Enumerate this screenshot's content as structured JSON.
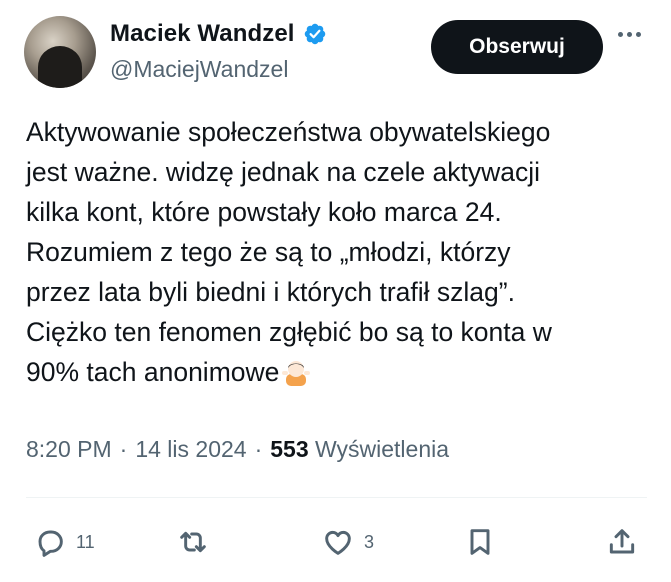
{
  "author": {
    "display_name": "Maciek Wandzel",
    "handle": "@MaciejWandzel",
    "verified_color": "#1d9bf0"
  },
  "follow_button_label": "Obserwuj",
  "tweet": {
    "text": "Aktywowanie społeczeństwa obywatelskiego\njest ważne. widzę jednak na czele aktywacji\nkilka kont, które powstały koło marca 24.\nRozumiem z tego że są to „młodzi, którzy\nprzez lata byli biedni i których trafił szlag”.\nCiężko ten fenomen zgłębić bo są to konta w\n90% tach anonimowe",
    "emoji": "person-shrugging-emoji"
  },
  "meta": {
    "time": "8:20 PM",
    "separator": "·",
    "date": "14 lis 2024",
    "views_count": "553",
    "views_label": "Wyświetlenia"
  },
  "actions": {
    "reply_count": "11",
    "retweet_count": "",
    "like_count": "3"
  },
  "colors": {
    "text": "#0f1419",
    "secondary": "#536471",
    "button_bg": "#0f1419",
    "divider": "#eff3f4"
  }
}
